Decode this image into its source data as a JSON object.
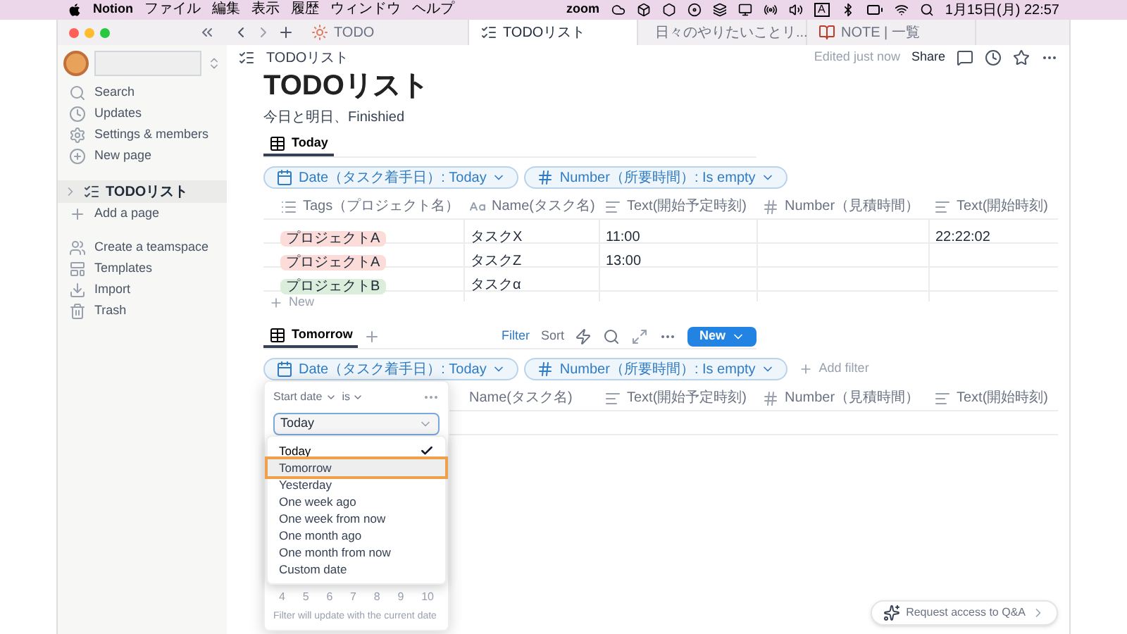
{
  "menu_bar": {
    "app": "Notion",
    "menus": [
      "ファイル",
      "編集",
      "表示",
      "履歴",
      "ウィンドウ",
      "ヘルプ"
    ],
    "zoom": "zoom",
    "input_source": "A",
    "clock": "1月15日(月) 22:57"
  },
  "tabs": [
    {
      "label": "TODO",
      "selected": false,
      "kind": "sun"
    },
    {
      "label": "TODOリスト",
      "selected": true,
      "kind": "checklist"
    },
    {
      "label": "日々のやりたいことリ...",
      "selected": false,
      "kind": "list"
    },
    {
      "label": "NOTE | 一覧",
      "selected": false,
      "kind": "book"
    }
  ],
  "sidebar": {
    "nav": [
      {
        "label": "Search",
        "kind": "search"
      },
      {
        "label": "Updates",
        "kind": "updates"
      },
      {
        "label": "Settings & members",
        "kind": "settings"
      },
      {
        "label": "New page",
        "kind": "new_page"
      }
    ],
    "pages": [
      {
        "label": "TODOリスト",
        "selected": true,
        "expanded": false
      }
    ],
    "add_page": "Add a page",
    "more": [
      {
        "label": "Create a teamspace",
        "kind": "teamspace"
      },
      {
        "label": "Templates",
        "kind": "templates"
      },
      {
        "label": "Import",
        "kind": "import"
      },
      {
        "label": "Trash",
        "kind": "trash"
      }
    ]
  },
  "page": {
    "breadcrumb": "TODOリスト",
    "edited": "Edited just now",
    "share": "Share",
    "title": "TODOリスト",
    "description": "今日と明日、Finishied",
    "views": [
      {
        "tab": "Today",
        "filters": [
          {
            "kind": "date",
            "label": "Date（タスク着手日）: Today"
          },
          {
            "kind": "number",
            "label": "Number（所要時間）: Is empty"
          }
        ],
        "columns": [
          {
            "kind": "tags",
            "label": "Tags（プロジェクト名）"
          },
          {
            "kind": "title",
            "label": "Name(タスク名)"
          },
          {
            "kind": "text",
            "label": "Text(開始予定時刻)"
          },
          {
            "kind": "number",
            "label": "Number（見積時間）"
          },
          {
            "kind": "text",
            "label": "Text(開始時刻)"
          }
        ],
        "rows": [
          {
            "cells": [
              {
                "label": "プロジェクトA",
                "color": "#fbdcd8"
              },
              "タスクX",
              "11:00",
              "",
              "22:22:02"
            ]
          },
          {
            "cells": [
              {
                "label": "プロジェクトA",
                "color": "#fbdcd8"
              },
              "タスクZ",
              "13:00",
              "",
              ""
            ]
          },
          {
            "cells": [
              {
                "label": "プロジェクトB",
                "color": "#dbeddb"
              },
              "タスクα",
              "",
              "",
              ""
            ]
          }
        ],
        "new_row": "New"
      },
      {
        "tab": "Tomorrow",
        "tools": [
          {
            "label": "Filter",
            "active": true
          },
          {
            "label": "Sort",
            "active": false
          }
        ],
        "new_button": "New",
        "filters": [
          {
            "kind": "date",
            "label": "Date（タスク着手日）: Today"
          },
          {
            "kind": "number",
            "label": "Number（所要時間）: Is empty"
          }
        ],
        "add_filter": "Add filter",
        "columns": [
          {
            "kind": "plain",
            "label": "Name(タスク名)"
          },
          {
            "kind": "text",
            "label": "Text(開始予定時刻)"
          },
          {
            "kind": "number",
            "label": "Number（見積時間）"
          },
          {
            "kind": "text",
            "label": "Text(開始時刻)"
          }
        ]
      }
    ]
  },
  "filter_popup": {
    "field": "Start date",
    "operator": "is",
    "value": "Today",
    "options": [
      {
        "label": "Today",
        "selected": true,
        "highlighted": false
      },
      {
        "label": "Tomorrow",
        "selected": false,
        "highlighted": true
      },
      {
        "label": "Yesterday",
        "selected": false,
        "highlighted": false
      },
      {
        "label": "One week ago",
        "selected": false,
        "highlighted": false
      },
      {
        "label": "One week from now",
        "selected": false,
        "highlighted": false
      },
      {
        "label": "One month ago",
        "selected": false,
        "highlighted": false
      },
      {
        "label": "One month from now",
        "selected": false,
        "highlighted": false
      },
      {
        "label": "Custom date",
        "selected": false,
        "highlighted": false
      }
    ],
    "calendar_row": [
      "4",
      "5",
      "6",
      "7",
      "8",
      "9",
      "10"
    ],
    "note": "Filter will update with the current date"
  },
  "qa_button": "Request access to Q&A"
}
